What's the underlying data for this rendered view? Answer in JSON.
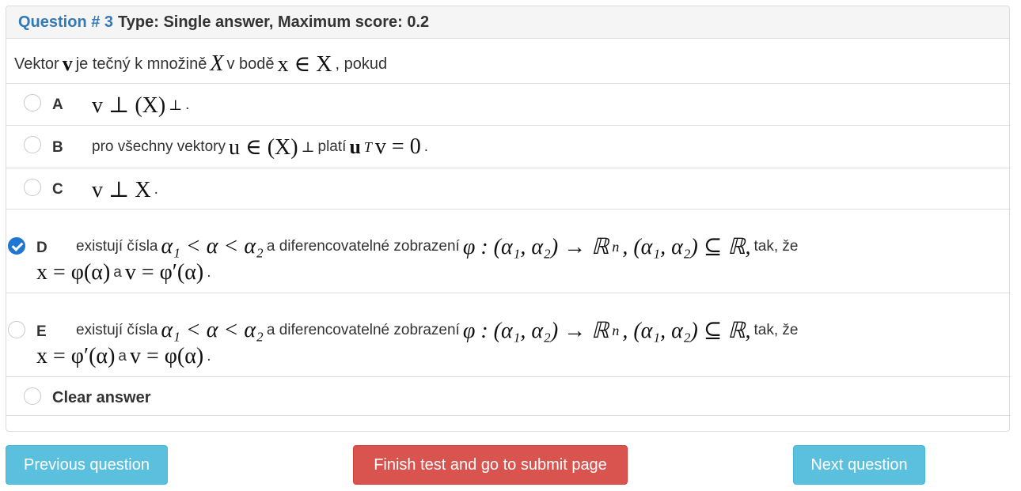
{
  "header": {
    "question_label": "Question # 3",
    "type_label": "Type: Single answer, Maximum score: 0.2"
  },
  "prompt": {
    "t1": "Vektor",
    "m1": "v",
    "t2": "je tečný k množině",
    "m2": "X",
    "t3": "v bodě",
    "m3": "x ∈ X",
    "t4": ", pokud"
  },
  "options": [
    {
      "letter": "A",
      "checked": false,
      "math": "v ⊥ (X)",
      "sup": "⊥",
      "end": "."
    },
    {
      "letter": "B",
      "checked": false,
      "t1": "pro všechny vektory",
      "m1": "u ∈ (X)",
      "sup1": "⊥",
      "t2": "platí",
      "m2": "u",
      "sup2": "T",
      "m3": "v = 0",
      "end": "."
    },
    {
      "letter": "C",
      "checked": false,
      "math": "v ⊥ X",
      "end": "."
    },
    {
      "letter": "D",
      "checked": true,
      "t1": "existují čísla",
      "m1": "α₁ < α < α₂",
      "t2": "a diferencovatelné zobrazení",
      "m2": "φ : (α₁, α₂) → ℝ",
      "sup": "n",
      "m3": ", (α₁, α₂) ⊆ ℝ,",
      "t3": "tak, že",
      "line2_m1": "x = φ(α)",
      "line2_t": "a",
      "line2_m2": "v = φ′(α)",
      "end": "."
    },
    {
      "letter": "E",
      "checked": false,
      "t1": "existují čísla",
      "m1": "α₁ < α < α₂",
      "t2": "a diferencovatelné zobrazení",
      "m2": "φ : (α₁, α₂) → ℝ",
      "sup": "n",
      "m3": ", (α₁, α₂) ⊆ ℝ,",
      "t3": "tak, že",
      "line2_m1": "x = φ′(α)",
      "line2_t": "a",
      "line2_m2": "v = φ(α)",
      "end": "."
    }
  ],
  "clear_answer_label": "Clear answer",
  "buttons": {
    "previous": "Previous question",
    "finish": "Finish test and go to submit page",
    "next": "Next question"
  },
  "colors": {
    "accent": "#337ab7",
    "checked": "#1f76d3",
    "info": "#5bc0de",
    "danger": "#d9534f"
  }
}
